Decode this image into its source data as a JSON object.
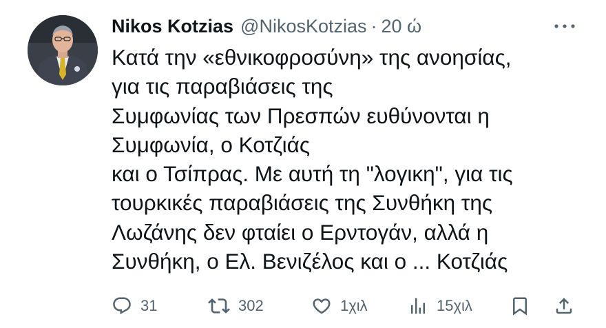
{
  "tweet": {
    "author": {
      "name": "Nikos Kotzias",
      "handle": "@NikosKotzias",
      "separator": "·",
      "time": "20 ώ",
      "avatar_icon": "profile-photo"
    },
    "more_icon": "more-horizontal-icon",
    "text_lines": [
      "Κατά την «εθνικοφροσύνη» της ανοησίας,",
      "για τις παραβιάσεις της",
      "Συμφωνίας των Πρεσπών ευθύνονται η",
      "Συμφωνία, ο Κοτζιάς",
      "και ο Τσίπρας. Με αυτή τη \"λογικη\", για τις",
      "τουρκικές παραβιάσεις της Συνθήκη της",
      "Λωζάνης δεν φταίει ο Ερντογάν, αλλά η",
      "Συνθήκη, ο Ελ. Βενιζέλος και ο ... Κοτζιάς"
    ],
    "actions": {
      "reply": {
        "icon": "reply-icon",
        "count": "31"
      },
      "retweet": {
        "icon": "retweet-icon",
        "count": "302"
      },
      "like": {
        "icon": "heart-icon",
        "count": "1χιλ"
      },
      "views": {
        "icon": "views-chart-icon",
        "count": "15χιλ"
      },
      "bookmark": {
        "icon": "bookmark-icon"
      },
      "share": {
        "icon": "share-icon"
      }
    },
    "colors": {
      "text": "#0f1419",
      "secondary": "#536471",
      "background": "#ffffff"
    }
  }
}
